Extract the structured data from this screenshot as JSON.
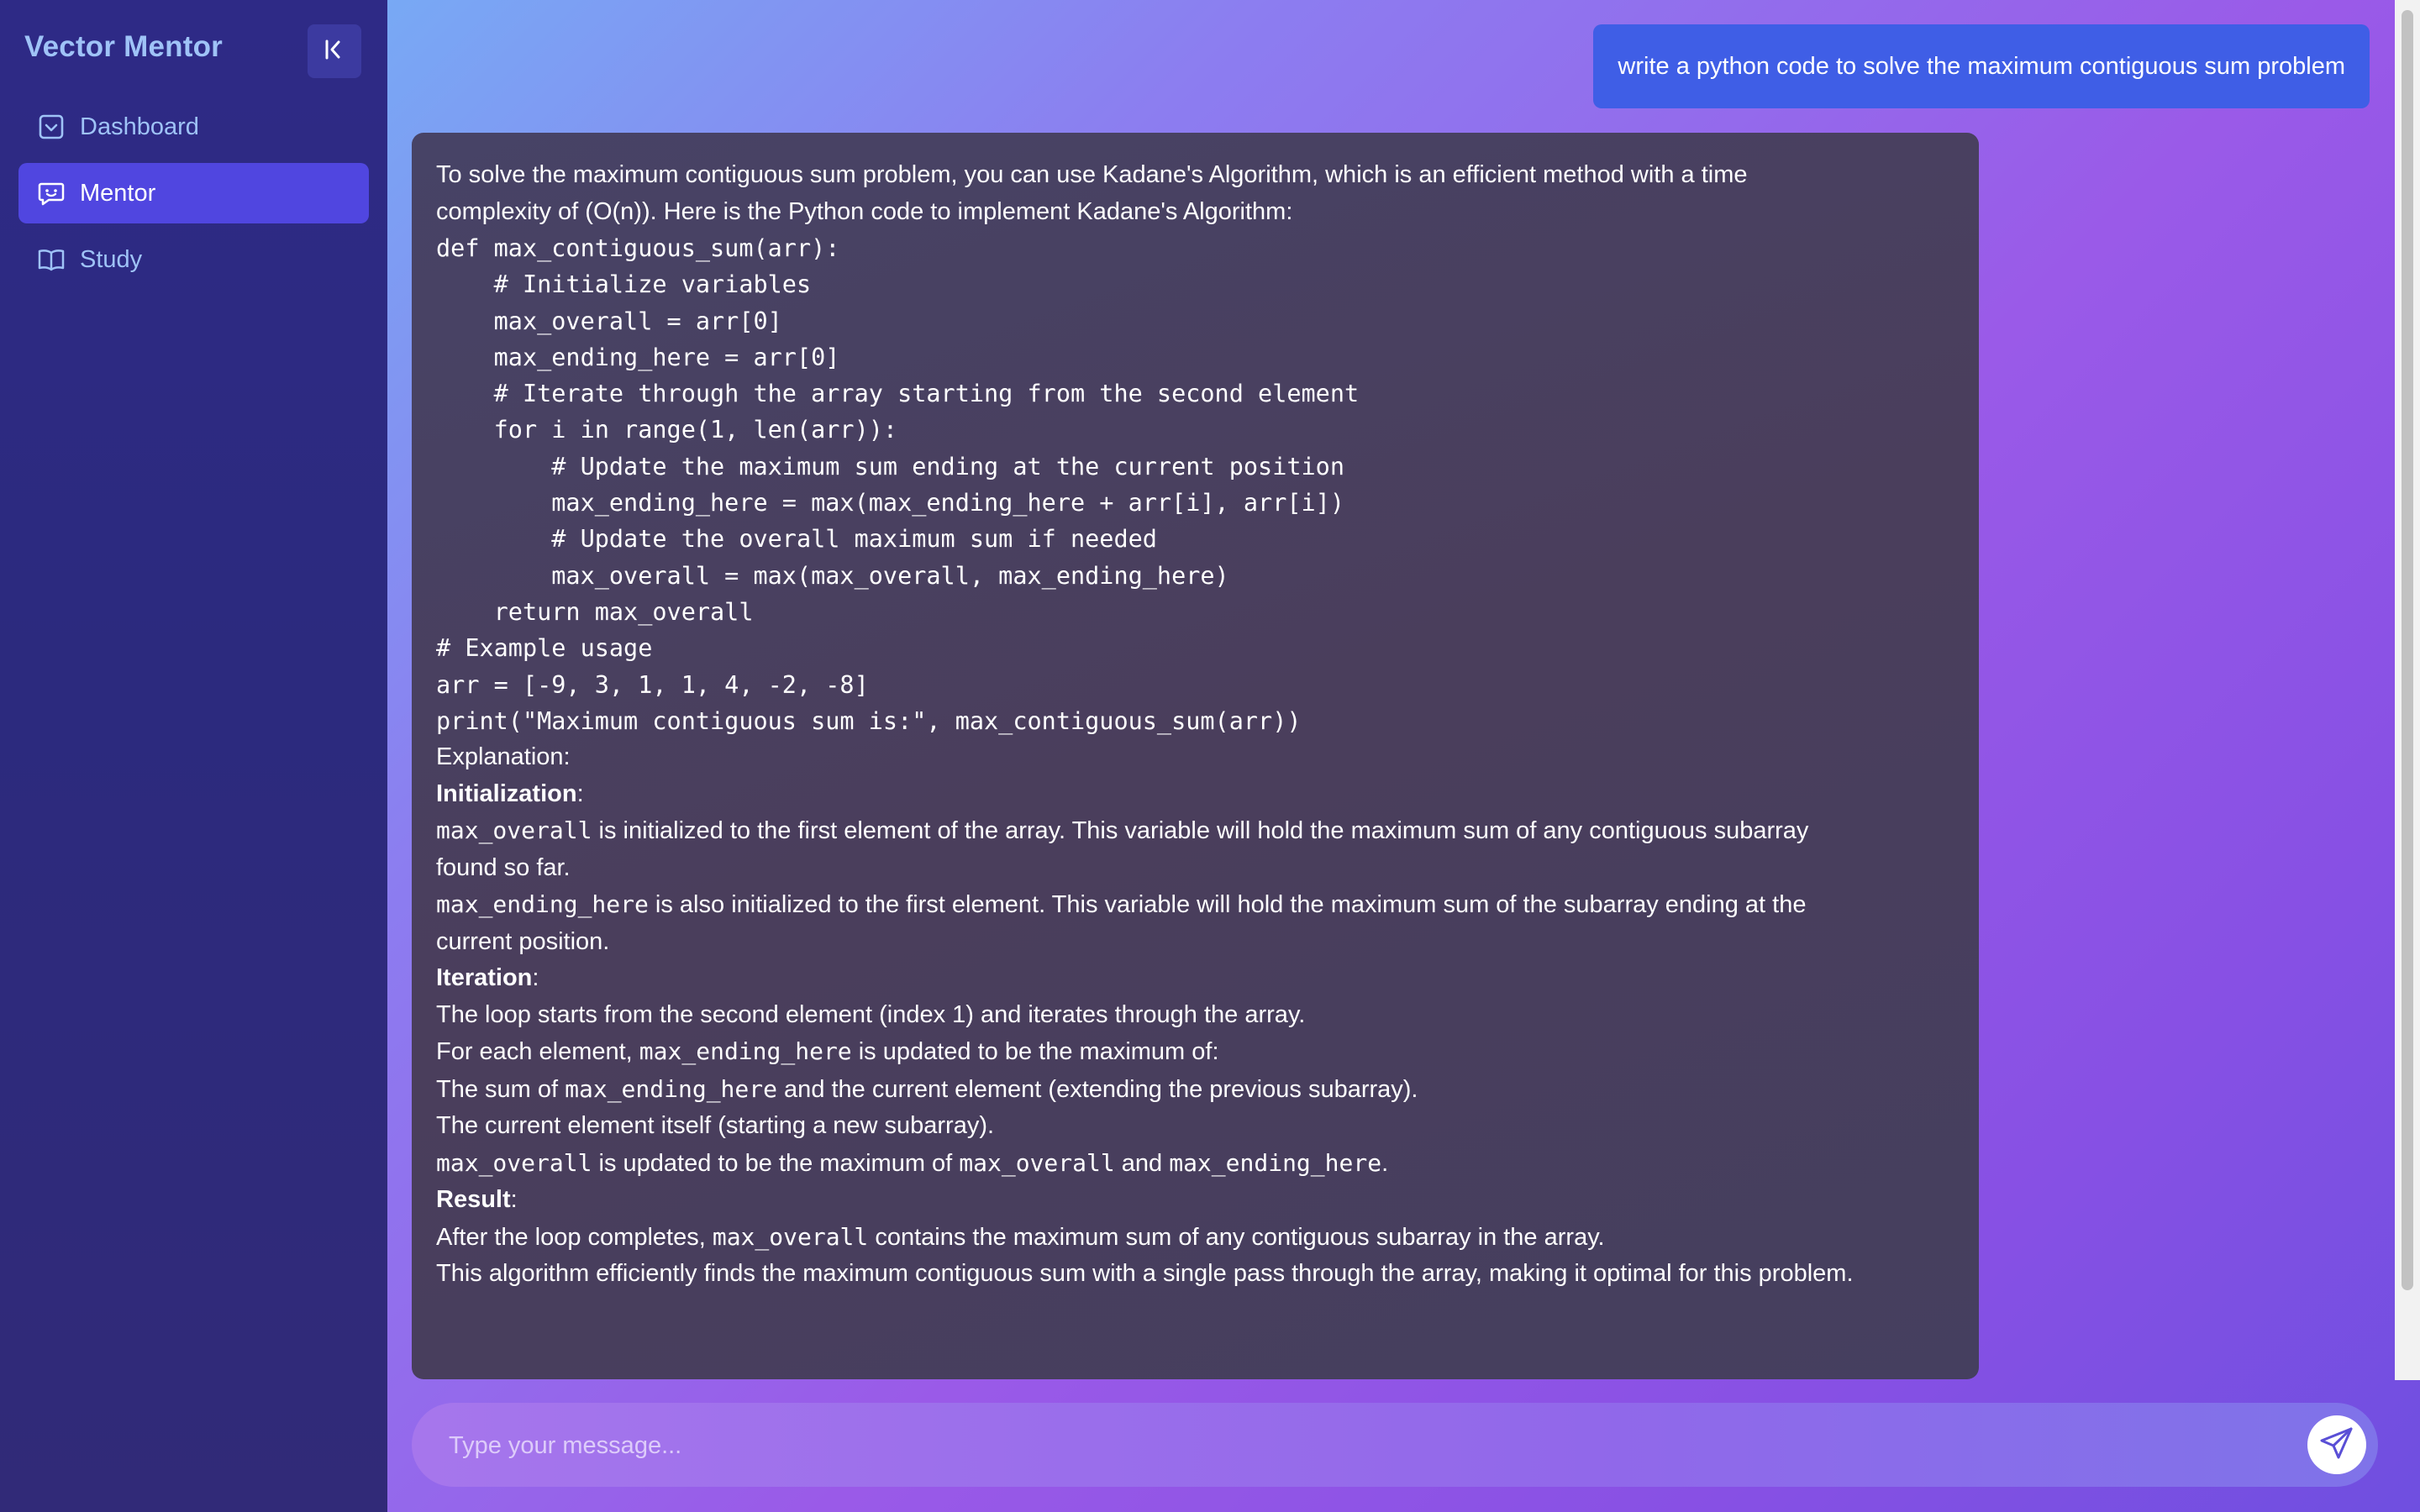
{
  "sidebar": {
    "brand": "Vector Mentor",
    "collapse_icon": "collapse-left-icon",
    "items": [
      {
        "label": "Dashboard",
        "icon": "dashboard-icon",
        "active": false
      },
      {
        "label": "Mentor",
        "icon": "chat-icon",
        "active": true
      },
      {
        "label": "Study",
        "icon": "book-icon",
        "active": false
      }
    ]
  },
  "chat": {
    "user_message": "write a python code to solve the maximum contiguous sum problem",
    "bot": {
      "intro_1": "To solve the maximum contiguous sum problem, you can use Kadane's Algorithm, which is an efficient method with a time",
      "intro_2": "complexity of (O(n)). Here is the Python code to implement Kadane's Algorithm:",
      "code": [
        "def max_contiguous_sum(arr):",
        "    # Initialize variables",
        "    max_overall = arr[0]",
        "    max_ending_here = arr[0]",
        "",
        "    # Iterate through the array starting from the second element",
        "    for i in range(1, len(arr)):",
        "        # Update the maximum sum ending at the current position",
        "        max_ending_here = max(max_ending_here + arr[i], arr[i])",
        "        # Update the overall maximum sum if needed",
        "        max_overall = max(max_overall, max_ending_here)",
        "",
        "    return max_overall",
        "",
        "# Example usage",
        "arr = [-9, 3, 1, 1, 4, -2, -8]",
        "print(\"Maximum contiguous sum is:\", max_contiguous_sum(arr))"
      ],
      "explanation_label": "Explanation:",
      "initialization_heading": "Initialization",
      "colon": ":",
      "init_line1_code": "max_overall",
      "init_line1_text": " is initialized to the first element of the array. This variable will hold the maximum sum of any contiguous subarray",
      "init_line1_cont": "found so far.",
      "init_line2_code": "max_ending_here",
      "init_line2_text": " is also initialized to the first element. This variable will hold the maximum sum of the subarray ending at the",
      "init_line2_cont": "current position.",
      "iteration_heading": "Iteration",
      "iter_line1": "The loop starts from the second element (index 1) and iterates through the array.",
      "iter_line2_a": "For each element, ",
      "iter_line2_code": "max_ending_here",
      "iter_line2_b": " is updated to be the maximum of:",
      "iter_line3_a": "The sum of ",
      "iter_line3_code": "max_ending_here",
      "iter_line3_b": " and the current element (extending the previous subarray).",
      "iter_line4": "The current element itself (starting a new subarray).",
      "iter_line5_code1": "max_overall",
      "iter_line5_a": " is updated to be the maximum of ",
      "iter_line5_code2": "max_overall",
      "iter_line5_b": " and ",
      "iter_line5_code3": "max_ending_here",
      "iter_line5_c": ".",
      "result_heading": "Result",
      "result_line1_a": "After the loop completes, ",
      "result_line1_code": "max_overall",
      "result_line1_b": " contains the maximum sum of any contiguous subarray in the array.",
      "result_line2": "This algorithm efficiently finds the maximum contiguous sum with a single pass through the array, making it optimal for this problem."
    }
  },
  "input": {
    "placeholder": "Type your message...",
    "value": ""
  },
  "send_icon": "send-icon",
  "colors": {
    "accent": "#5046e0",
    "user_bubble": "#3f5ee6",
    "brand_text": "#9fc3f7"
  }
}
